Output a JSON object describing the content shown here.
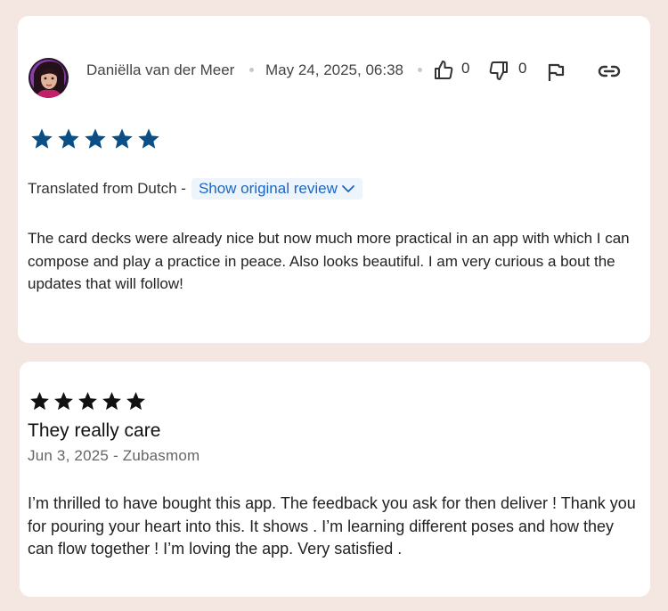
{
  "review1": {
    "author": "Daniëlla van der Meer",
    "date": "May 24, 2025, 06:38",
    "thumbs_up_count": "0",
    "thumbs_down_count": "0",
    "rating": 5,
    "translated_label": "Translated from Dutch -",
    "show_original_label": "Show original review",
    "text": "The card decks were already nice but now much more practical in an app with which I can compose and play a practice in peace. Also looks beautiful. I am very curious a bout the updates that will follow!",
    "star_color": "#0b4f86",
    "icons": [
      "thumbs-up-icon",
      "thumbs-down-icon",
      "flag-icon",
      "link-icon",
      "chevron-down-icon"
    ]
  },
  "review2": {
    "rating": 5,
    "title": "They really care",
    "meta": "Jun 3, 2025 - Zubasmom",
    "text": "I’m thrilled to have bought this app. The feedback you ask for then deliver ! Thank you for pouring your heart into this. It shows . I’m learning different poses and how they can flow together ! I’m loving the app. Very satisfied .",
    "star_color": "#111111"
  },
  "colors": {
    "background": "#f4e6e0",
    "card": "#ffffff",
    "link": "#1a66c4"
  }
}
